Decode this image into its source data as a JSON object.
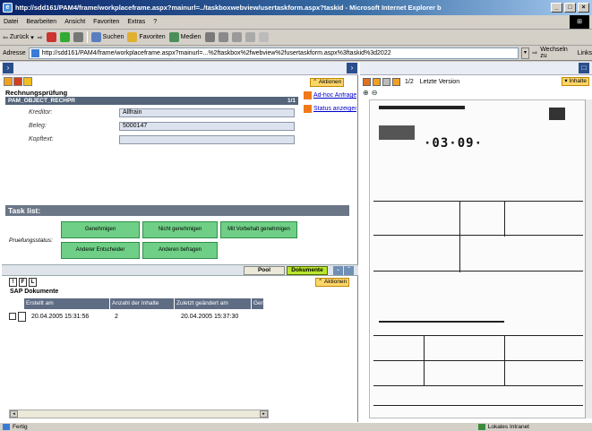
{
  "window": {
    "title": "http://sdd161/PAM4/frame/workplaceframe.aspx?mainurl=../taskboxwebview/usertaskform.aspx?taskid - Microsoft Internet Explorer b"
  },
  "menu": [
    "Datei",
    "Bearbeiten",
    "Ansicht",
    "Favoriten",
    "Extras",
    "?"
  ],
  "toolbar": {
    "back": "Zurück",
    "search": "Suchen",
    "favorites": "Favoriten",
    "media": "Medien"
  },
  "address": {
    "label": "Adresse",
    "url": "http://sdd161/PAM4/frame/workplaceframe.aspx?mainurl=...%2ftaskbox%2fwebview%2fusertaskform.aspx%3ftaskid%3d2022",
    "go": "Wechseln zu",
    "links": "Links"
  },
  "left": {
    "aktionen_top": "Aktionen",
    "section_title": "Rechnungsprüfung",
    "object_bar": "PAM_OBJECT_RECHPR",
    "object_page": "1/1",
    "fields": [
      {
        "label": "Kreditor:",
        "value": "Allfrain"
      },
      {
        "label": "Beleg:",
        "value": "5000147"
      },
      {
        "label": "Kopftext:",
        "value": ""
      }
    ],
    "adhoc": "Ad-hoc Anfrage",
    "status": "Status anzeigen",
    "tasklist_title": "Task list:",
    "buttons": [
      "Genehmigen",
      "Nicht genehmigen",
      "Mit Vorbehalt genehmigen",
      "Anderer Entscheider",
      "Anderen befragen"
    ],
    "pruefungsstatus": "Pruefungsstatus:",
    "pool": "Pool",
    "dokumente": "Dokumente",
    "aktionen_bottom": "Aktionen",
    "sap_title": "SAP Dokumente",
    "table_headers": [
      "Erstellt am",
      "Anzahl der Inhalte",
      "Zuletzt geändert am",
      "Gen"
    ],
    "table_row": {
      "created": "20.04.2005 15:31:56",
      "count": "2",
      "modified": "20.04.2005 15:37:30"
    }
  },
  "right": {
    "page": "1/2",
    "version": "Letzte Version",
    "inhalte": "Inhalte"
  },
  "status": {
    "left": "Fertig",
    "zone": "Lokales Intranet"
  }
}
